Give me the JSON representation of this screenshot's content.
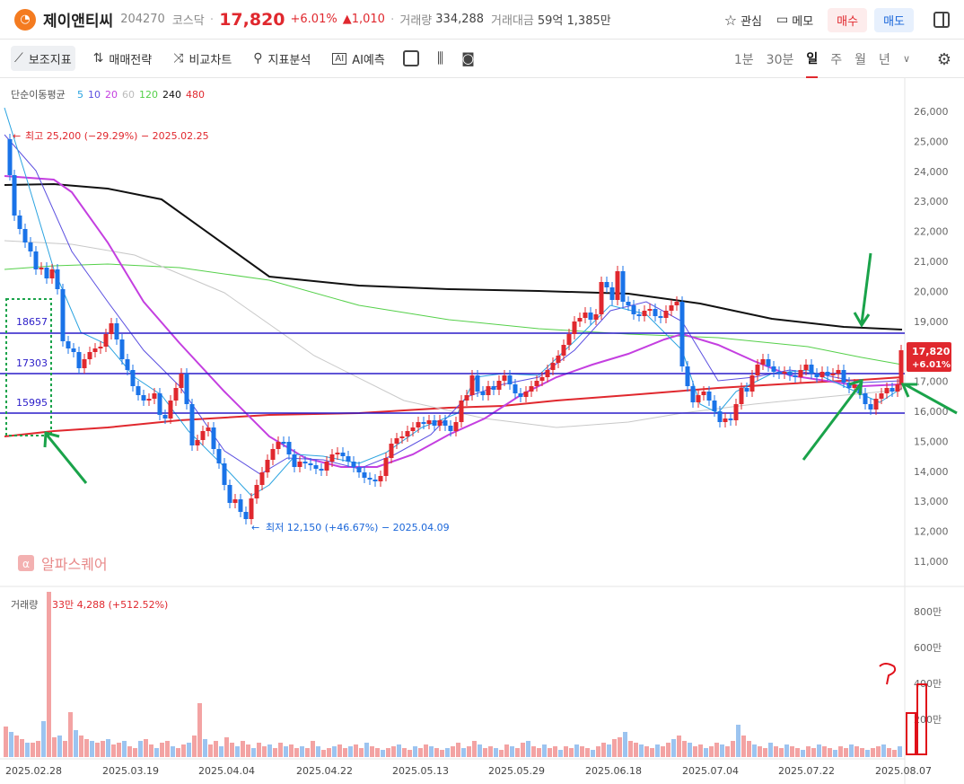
{
  "header": {
    "logo_glyph": "◔",
    "name": "제이앤티씨",
    "code": "204270",
    "market": "코스닥",
    "price": "17,820",
    "change_pct": "+6.01%",
    "change_amt": "▲1,010",
    "volume_label": "거래량",
    "volume_value": "334,288",
    "amount_label": "거래대금",
    "amount_value": "59억 1,385만",
    "watch_label": "관심",
    "memo_label": "메모",
    "buy_label": "매수",
    "sell_label": "매도"
  },
  "toolbar": {
    "tools": [
      "보조지표",
      "매매전략",
      "비교차트",
      "지표분석",
      "AI예측"
    ],
    "periods": [
      "1분",
      "30분",
      "일",
      "주",
      "월",
      "년"
    ],
    "active_period": "일"
  },
  "legend": {
    "ma_label": "단순이동평균",
    "ma_periods": [
      "5",
      "10",
      "20",
      "60",
      "120",
      "240",
      "480"
    ],
    "ma_colors": [
      "#2aa3e0",
      "#5b4fe0",
      "#c43fe0",
      "#bbbbbb",
      "#55d04a",
      "#111111",
      "#e0282e"
    ]
  },
  "annotations": {
    "high": "최고 25,200 (−29.29%) − 2025.02.25",
    "low": "최저 12,150 (+46.67%) − 2025.04.09",
    "watermark": "알파스퀘어",
    "level_labels": [
      "18657",
      "17303",
      "15995"
    ],
    "price_tag_value": "17,820",
    "price_tag_pct": "+6.01%"
  },
  "volume": {
    "label": "거래량",
    "value": "33만 4,288 (+512.52%)",
    "axis_labels": [
      "800만",
      "600만",
      "400만",
      "200만"
    ]
  },
  "chart_data": {
    "type": "candlestick",
    "y_axis_labels": [
      "26,000",
      "25,000",
      "24,000",
      "23,000",
      "22,000",
      "21,000",
      "20,000",
      "19,000",
      "18,000",
      "17,000",
      "16,000",
      "15,000",
      "14,000",
      "13,000",
      "12,000",
      "11,000"
    ],
    "x_axis_labels": [
      "2025.02.28",
      "2025.03.19",
      "2025.04.04",
      "2025.04.22",
      "2025.05.13",
      "2025.05.29",
      "2025.06.18",
      "2025.07.04",
      "2025.07.22",
      "2025.08.07"
    ],
    "levels": [
      18657,
      17303,
      15995
    ],
    "last_price": 17820,
    "high": 25200,
    "low": 12150
  }
}
